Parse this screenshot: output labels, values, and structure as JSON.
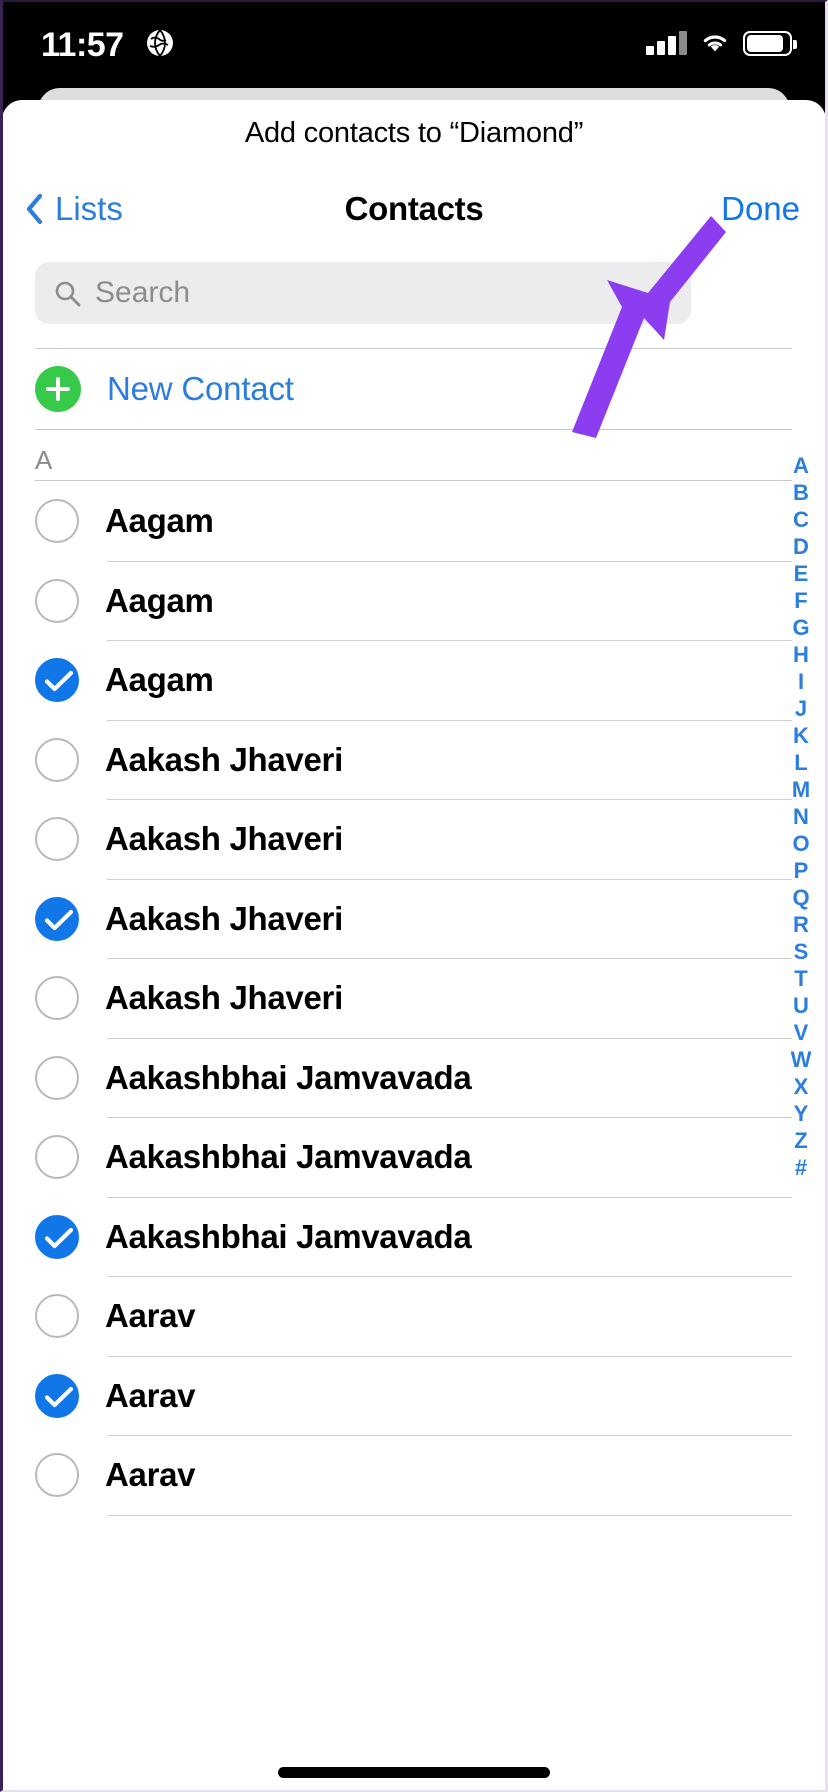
{
  "status_bar": {
    "time": "11:57",
    "location_icon": "globe-icon",
    "signal_icon": "cellular-signal-icon",
    "wifi_icon": "wifi-icon",
    "battery_icon": "battery-icon"
  },
  "sheet": {
    "title": "Add contacts to “Diamond”",
    "list_name": "Diamond"
  },
  "nav": {
    "back_label": "Lists",
    "back_icon": "chevron-left-icon",
    "title": "Contacts",
    "done_label": "Done"
  },
  "search": {
    "placeholder": "Search",
    "value": "",
    "icon": "search-icon"
  },
  "new_contact": {
    "label": "New Contact",
    "icon": "plus-circle-icon"
  },
  "section": {
    "header": "A"
  },
  "contacts": [
    {
      "name": "Aagam",
      "selected": false
    },
    {
      "name": "Aagam",
      "selected": false
    },
    {
      "name": "Aagam",
      "selected": true
    },
    {
      "name": "Aakash Jhaveri",
      "selected": false
    },
    {
      "name": "Aakash Jhaveri",
      "selected": false
    },
    {
      "name": "Aakash Jhaveri",
      "selected": true
    },
    {
      "name": "Aakash Jhaveri",
      "selected": false
    },
    {
      "name": "Aakashbhai Jamvavada",
      "selected": false
    },
    {
      "name": "Aakashbhai Jamvavada",
      "selected": false
    },
    {
      "name": "Aakashbhai Jamvavada",
      "selected": true
    },
    {
      "name": "Aarav",
      "selected": false
    },
    {
      "name": "Aarav",
      "selected": true
    },
    {
      "name": "Aarav",
      "selected": false
    }
  ],
  "alpha_index": [
    "A",
    "B",
    "C",
    "D",
    "E",
    "F",
    "G",
    "H",
    "I",
    "J",
    "K",
    "L",
    "M",
    "N",
    "O",
    "P",
    "Q",
    "R",
    "S",
    "T",
    "U",
    "V",
    "W",
    "X",
    "Y",
    "Z",
    "#"
  ],
  "annotation": {
    "type": "arrow",
    "points_to": "Done",
    "color": "#8b3def"
  },
  "colors": {
    "accent_blue": "#1177e8",
    "link_blue": "#2b7de0",
    "green": "#36c94a",
    "annotation_purple": "#8b3def",
    "separator": "#cfcfd2",
    "search_bg": "#ececee",
    "section_gray": "#8a8a8e"
  }
}
